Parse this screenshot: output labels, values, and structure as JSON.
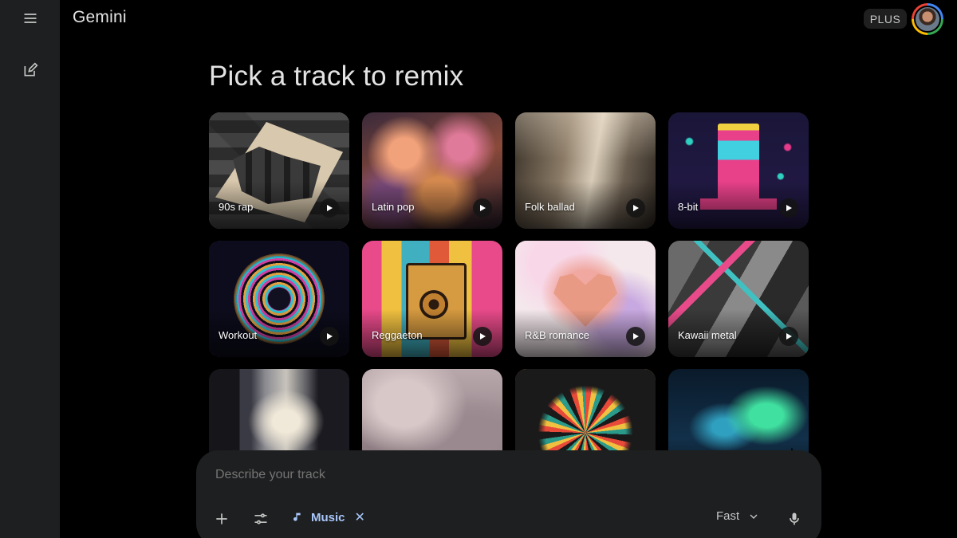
{
  "app": {
    "title": "Gemini",
    "plan_badge": "PLUS"
  },
  "page": {
    "title": "Pick a track to remix"
  },
  "tracks": [
    {
      "label": "90s rap",
      "art": "art-rap"
    },
    {
      "label": "Latin pop",
      "art": "art-latin"
    },
    {
      "label": "Folk ballad",
      "art": "art-folk"
    },
    {
      "label": "8-bit",
      "art": "art-8bit"
    },
    {
      "label": "Workout",
      "art": "art-workout"
    },
    {
      "label": "Reggaeton",
      "art": "art-reggaeton"
    },
    {
      "label": "R&B romance",
      "art": "art-rnb"
    },
    {
      "label": "Kawaii metal",
      "art": "art-kawaii"
    },
    {
      "label": "",
      "art": "art-cave"
    },
    {
      "label": "",
      "art": "art-clouds"
    },
    {
      "label": "",
      "art": "art-swirl"
    },
    {
      "label": "",
      "art": "art-aurora"
    }
  ],
  "prompt": {
    "placeholder": "Describe your track",
    "chip_label": "Music",
    "speed_label": "Fast"
  },
  "icons": {
    "menu": "menu-icon",
    "new_chat": "edit-icon",
    "add": "plus-icon",
    "tools": "tune-icon",
    "music": "music-note-icon",
    "remove": "close-icon",
    "dropdown": "chevron-down-icon",
    "mic": "mic-icon",
    "play": "play-icon"
  },
  "colors": {
    "accent": "#a8c7fa",
    "surface": "#1e1f20",
    "background": "#000000"
  }
}
